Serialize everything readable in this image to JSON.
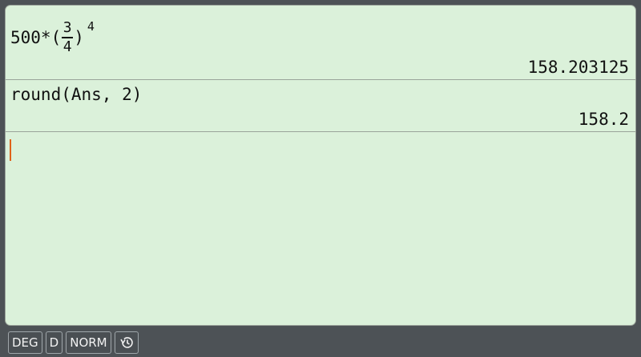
{
  "history": [
    {
      "expression": {
        "prefix": "500*(",
        "numerator": "3",
        "denominator": "4",
        "suffix": ")",
        "exponent": "4"
      },
      "result": "158.203125"
    },
    {
      "expression_text": "round(Ans, 2)",
      "result": "158.2"
    }
  ],
  "status_bar": {
    "angle_mode": "DEG",
    "display_mode": "D",
    "number_format": "NORM",
    "history_icon": "history-icon"
  },
  "colors": {
    "screen_background": "#dbf1da",
    "frame": "#4d5256",
    "cursor": "#e0621a"
  }
}
